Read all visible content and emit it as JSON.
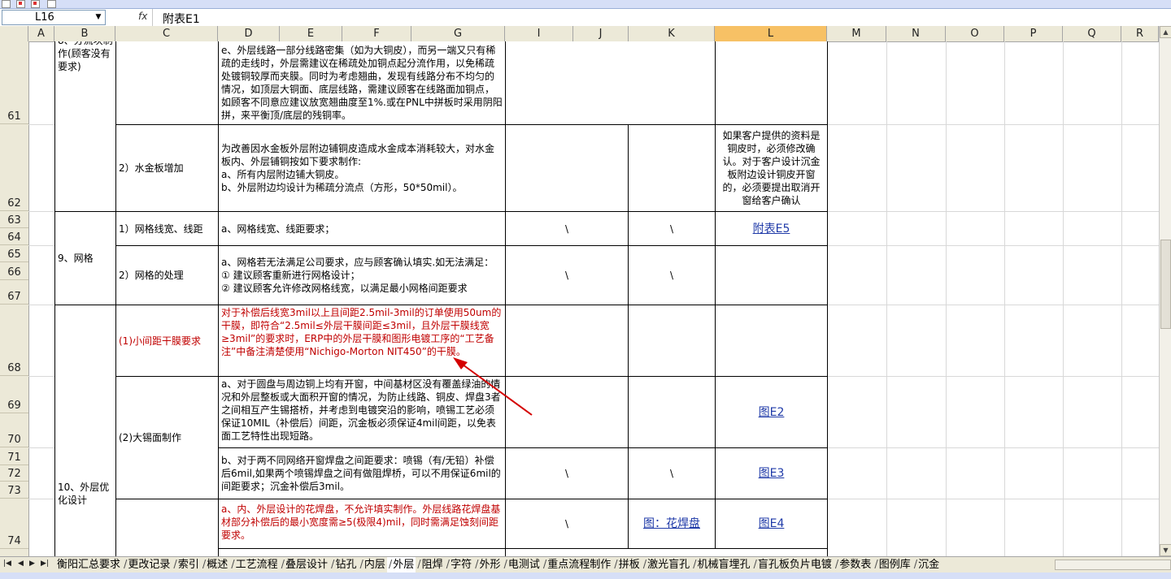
{
  "formula_bar": {
    "name_box": "L16",
    "fx_label": "fx",
    "formula": "附表E1"
  },
  "columns": [
    "A",
    "B",
    "C",
    "D",
    "E",
    "F",
    "G",
    "I",
    "J",
    "K",
    "L",
    "M",
    "N",
    "O",
    "P",
    "Q",
    "R"
  ],
  "rows": [
    "61",
    "62",
    "63",
    "64",
    "65",
    "66",
    "67",
    "68",
    "69",
    "70",
    "71",
    "72",
    "73",
    "74"
  ],
  "cells": {
    "b_flow": "8、分流块制作(顾客没有要求)",
    "d61": "e、外层线路一部分线路密集（如为大铜皮），而另一端又只有稀疏的走线时，外层需建议在稀疏处加铜点起分流作用，以免稀疏处镀铜较厚而夹膜。同时为考虑翘曲，发现有线路分布不均匀的情况，如顶层大铜面、底层线路，需建议顾客在线路面加铜点，如顾客不同意应建议放宽翘曲度至1%.或在PNL中拼板时采用阴阳拼，来平衡顶/底层的残铜率。",
    "c62": "2）水金板增加",
    "d62": "为改善因水金板外层附边铺铜皮造成水金成本消耗较大，对水金板内、外层铺铜按如下要求制作:\na、所有内层附边铺大铜皮。\nb、外层附边均设计为稀疏分流点（方形，50*50mil）。",
    "l62": "如果客户提供的资料是铜皮时，必须修改确认。对于客户设计沉金板附边设计铜皮开窗的，必须要提出取消开窗给客户确认",
    "b_grid": "9、网格",
    "c63": "1）网格线宽、线距",
    "d63": "a、网格线宽、线距要求；",
    "i63": "\\",
    "k63": "\\",
    "l63": "附表E5",
    "c65": "2）网格的处理",
    "d65": "a、网格若无法满足公司要求，应与顾客确认填实.如无法满足：\n①  建议顾客重新进行网格设计；\n②  建议顾客允许修改网格线宽，以满足最小网格间距要求",
    "i65": "\\",
    "k65": "\\",
    "b_outer": "10、外层优化设计",
    "c68": "(1)小间距干膜要求",
    "d68": "对于补偿后线宽3mil以上且间距2.5mil-3mil的订单使用50um的干膜，即符合“2.5mil≤外层干膜间距≤3mil，且外层干膜线宽≥3mil”的要求时，ERP中的外层干膜和图形电镀工序的“工艺备注”中备注清楚使用“Nichigo-Morton NIT450”的干膜。",
    "c69": "(2)大锡面制作",
    "d69": "a、对于圆盘与周边铜上均有开窗，中间基材区没有覆盖绿油的情况和外层整板或大面积开窗的情况，为防止线路、铜皮、焊盘3者之间相互产生锡搭桥，并考虑到电镀突沿的影响，喷锡工艺必须保证10MIL（补偿后）间距，沉金板必须保证4mil间距，以免表面工艺特性出现短路。",
    "l69": "图E2",
    "d71": "b、对于两不同网络开窗焊盘之间距要求：喷锡（有/无铅）补偿后6mil,如果两个喷锡焊盘之间有做阻焊桥，可以不用保证6mil的间距要求；沉金补偿后3mil。",
    "i71": "\\",
    "k71": "\\",
    "l71": "图E3",
    "d74": "a、内、外层设计的花焊盘，不允许填实制作。外层线路花焊盘基材部分补偿后的最小宽度需≥5(极限4)mil，同时需满足蚀刻间距要求。",
    "i74": "\\",
    "k74": "图：花焊盘",
    "l74": "图E4"
  },
  "sheet_tabs": [
    "衡阳汇总要求",
    "更改记录",
    "索引",
    "概述",
    "工艺流程",
    "叠层设计",
    "钻孔",
    "内层",
    "外层",
    "阻焊",
    "字符",
    "外形",
    "电测试",
    "重点流程制作",
    "拼板",
    "激光盲孔",
    "机械盲埋孔",
    "盲孔板负片电镀",
    "参数表",
    "图例库",
    "沉金"
  ],
  "active_tab": "外层",
  "colors": {
    "red_text": "#c00000",
    "link": "#1f3aa8",
    "selected_header": "#f7c165",
    "header_bg": "#ece9d8"
  }
}
